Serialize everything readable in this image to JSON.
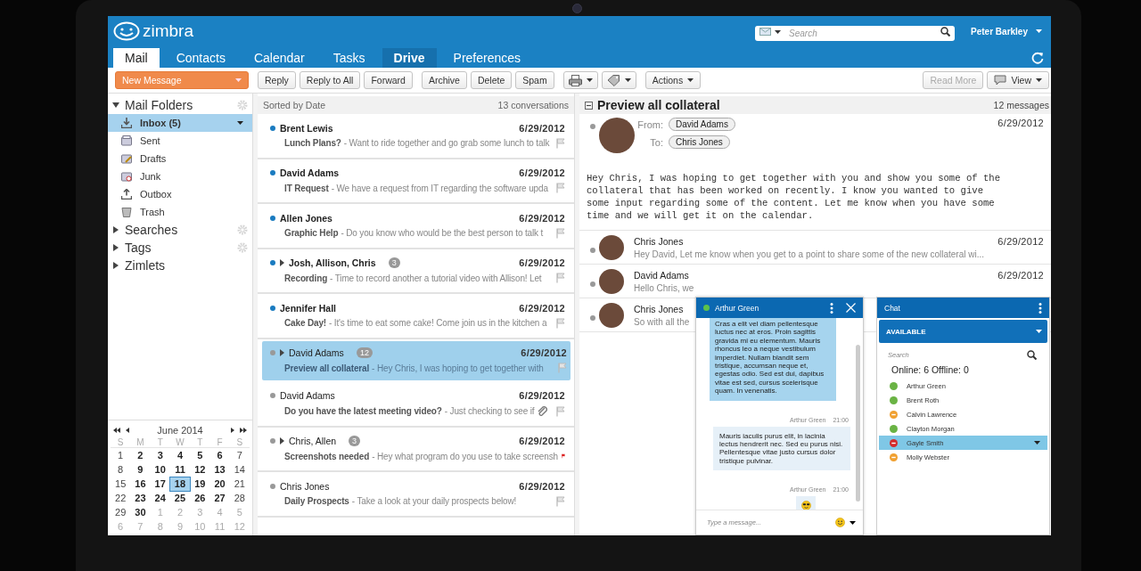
{
  "header": {
    "logo": "zimbra",
    "search": {
      "placeholder": "Search"
    },
    "user": "Peter Barkley"
  },
  "tabs": [
    {
      "label": "Mail",
      "selected": true,
      "highlighted": false
    },
    {
      "label": "Contacts",
      "selected": false,
      "highlighted": false
    },
    {
      "label": "Calendar",
      "selected": false,
      "highlighted": false
    },
    {
      "label": "Tasks",
      "selected": false,
      "highlighted": false
    },
    {
      "label": "Drive",
      "selected": false,
      "highlighted": true
    },
    {
      "label": "Preferences",
      "selected": false,
      "highlighted": false
    }
  ],
  "toolbar": {
    "groups": [
      [
        {
          "kind": "primary",
          "label": "New Message"
        }
      ],
      [
        {
          "kind": "button",
          "label": "Reply"
        },
        {
          "kind": "button",
          "label": "Reply to All"
        },
        {
          "kind": "button",
          "label": "Forward"
        }
      ],
      [
        {
          "kind": "button",
          "label": "Archive"
        },
        {
          "kind": "button",
          "label": "Delete"
        },
        {
          "kind": "button",
          "label": "Spam"
        }
      ],
      [
        {
          "kind": "print-menu"
        },
        {
          "kind": "tag-menu"
        }
      ],
      [
        {
          "kind": "menu",
          "label": "Actions"
        }
      ]
    ],
    "right": [
      {
        "kind": "button",
        "label": "Read More",
        "disabled": true
      },
      {
        "kind": "view-menu",
        "label": "View",
        "disabled": false
      }
    ]
  },
  "sidebar": {
    "sections": [
      {
        "label": "Mail Folders",
        "expanded": true,
        "settings": true,
        "children": [
          {
            "label": "Inbox (5)",
            "kind": "inbox",
            "selected": true
          },
          {
            "label": "Sent",
            "kind": "sent",
            "selected": false
          },
          {
            "label": "Drafts",
            "kind": "drafts",
            "selected": false
          },
          {
            "label": "Junk",
            "kind": "junk",
            "selected": false
          },
          {
            "label": "Outbox",
            "kind": "outbox",
            "selected": false
          },
          {
            "label": "Trash",
            "kind": "trash",
            "selected": false
          }
        ]
      },
      {
        "label": "Searches",
        "expanded": false,
        "settings": true
      },
      {
        "label": "Tags",
        "expanded": false,
        "settings": true
      },
      {
        "label": "Zimlets",
        "expanded": false,
        "settings": false
      }
    ]
  },
  "calendar": {
    "month": "June 2014",
    "weekdays": [
      "S",
      "M",
      "T",
      "W",
      "T",
      "F",
      "S"
    ],
    "weeks": [
      [
        {
          "day": "1",
          "kind": "weekend",
          "selected": false
        },
        {
          "day": "2",
          "kind": "weekday",
          "selected": false
        },
        {
          "day": "3",
          "kind": "weekday",
          "selected": false
        },
        {
          "day": "4",
          "kind": "weekday",
          "selected": false
        },
        {
          "day": "5",
          "kind": "weekday",
          "selected": false
        },
        {
          "day": "6",
          "kind": "weekday",
          "selected": false
        },
        {
          "day": "7",
          "kind": "weekend",
          "selected": false
        }
      ],
      [
        {
          "day": "8",
          "kind": "weekend",
          "selected": false
        },
        {
          "day": "9",
          "kind": "weekday",
          "selected": false
        },
        {
          "day": "10",
          "kind": "weekday",
          "selected": false
        },
        {
          "day": "11",
          "kind": "weekday",
          "selected": false
        },
        {
          "day": "12",
          "kind": "weekday",
          "selected": false
        },
        {
          "day": "13",
          "kind": "weekday",
          "selected": false
        },
        {
          "day": "14",
          "kind": "weekend",
          "selected": false
        }
      ],
      [
        {
          "day": "15",
          "kind": "weekend",
          "selected": false
        },
        {
          "day": "16",
          "kind": "weekday",
          "selected": false
        },
        {
          "day": "17",
          "kind": "weekday",
          "selected": false
        },
        {
          "day": "18",
          "kind": "weekday",
          "selected": true
        },
        {
          "day": "19",
          "kind": "weekday",
          "selected": false
        },
        {
          "day": "20",
          "kind": "weekday",
          "selected": false
        },
        {
          "day": "21",
          "kind": "weekend",
          "selected": false
        }
      ],
      [
        {
          "day": "22",
          "kind": "weekend",
          "selected": false
        },
        {
          "day": "23",
          "kind": "weekday",
          "selected": false
        },
        {
          "day": "24",
          "kind": "weekday",
          "selected": false
        },
        {
          "day": "25",
          "kind": "weekday",
          "selected": false
        },
        {
          "day": "26",
          "kind": "weekday",
          "selected": false
        },
        {
          "day": "27",
          "kind": "weekday",
          "selected": false
        },
        {
          "day": "28",
          "kind": "weekend",
          "selected": false
        }
      ],
      [
        {
          "day": "29",
          "kind": "weekend",
          "selected": false
        },
        {
          "day": "30",
          "kind": "weekday",
          "selected": false
        },
        {
          "day": "1",
          "kind": "other",
          "selected": false
        },
        {
          "day": "2",
          "kind": "other",
          "selected": false
        },
        {
          "day": "3",
          "kind": "other",
          "selected": false
        },
        {
          "day": "4",
          "kind": "other",
          "selected": false
        },
        {
          "day": "5",
          "kind": "other",
          "selected": false
        }
      ],
      [
        {
          "day": "6",
          "kind": "other",
          "selected": false
        },
        {
          "day": "7",
          "kind": "other",
          "selected": false
        },
        {
          "day": "8",
          "kind": "other",
          "selected": false
        },
        {
          "day": "9",
          "kind": "other",
          "selected": false
        },
        {
          "day": "10",
          "kind": "other",
          "selected": false
        },
        {
          "day": "11",
          "kind": "other",
          "selected": false
        },
        {
          "day": "12",
          "kind": "other",
          "selected": false
        }
      ]
    ]
  },
  "message_list": {
    "sort": "Sorted by Date",
    "count": "13 conversations",
    "rows": [
      {
        "sender": "Brent Lewis",
        "date": "6/29/2012",
        "subject": "Lunch Plans?",
        "snippet": "- Want to ride together and go grab some lunch to talk",
        "unread": true,
        "thread": false,
        "flagged": false,
        "attachment": false,
        "selected": false
      },
      {
        "sender": "David Adams",
        "date": "6/29/2012",
        "subject": "IT Request",
        "snippet": "- We have a request from IT regarding the software upda",
        "unread": true,
        "thread": false,
        "flagged": false,
        "attachment": false,
        "selected": false
      },
      {
        "sender": "Allen Jones",
        "date": "6/29/2012",
        "subject": "Graphic Help",
        "snippet": "- Do you know who would be the best person to talk t",
        "unread": true,
        "thread": false,
        "flagged": false,
        "attachment": false,
        "selected": false
      },
      {
        "sender": "Josh, Allison, Chris",
        "count": "3",
        "date": "6/29/2012",
        "subject": "Recording",
        "snippet": "- Time to record another a tutorial video with Allison! Let",
        "unread": true,
        "thread": true,
        "flagged": false,
        "attachment": false,
        "selected": false
      },
      {
        "sender": "Jennifer Hall",
        "date": "6/29/2012",
        "subject": "Cake Day!",
        "snippet": "- It's time to eat some cake! Come join us in the kitchen a",
        "unread": true,
        "thread": false,
        "flagged": false,
        "attachment": false,
        "selected": false
      },
      {
        "sender": "David Adams",
        "count": "12",
        "date": "6/29/2012",
        "subject": "Preview all collateral",
        "snippet": "- Hey Chris, I was hoping to get together with",
        "unread": false,
        "thread": true,
        "flagged": false,
        "attachment": false,
        "selected": true
      },
      {
        "sender": "David Adams",
        "date": "6/29/2012",
        "subject": "Do you have the latest meeting video?",
        "snippet": "- Just checking to see if",
        "unread": false,
        "thread": false,
        "flagged": false,
        "attachment": true,
        "selected": false
      },
      {
        "sender": "Chris, Allen",
        "count": "3",
        "date": "6/29/2012",
        "subject": "Screenshots needed",
        "snippet": "- Hey what program do you use to take screensh",
        "unread": false,
        "thread": true,
        "flagged": true,
        "attachment": false,
        "selected": false
      },
      {
        "sender": "Chris Jones",
        "date": "6/29/2012",
        "subject": "Daily Prospects",
        "snippet": "- Take a look at your daily prospects below!",
        "unread": false,
        "thread": false,
        "flagged": false,
        "attachment": false,
        "selected": false
      }
    ]
  },
  "reading_pane": {
    "title": "Preview all collateral",
    "count": "12 messages",
    "message": {
      "from_label": "From:",
      "from": "David Adams",
      "to_label": "To:",
      "to": "Chris Jones",
      "date": "6/29/2012",
      "body": "Hey Chris, I was hoping to get together with you and show you some of the collateral that has been worked on recently. I know you wanted to give some input regarding some of the content. Let me know when you have some time and we will get it on the calendar."
    },
    "thread": [
      {
        "name": "Chris Jones",
        "date": "6/29/2012",
        "snippet": "Hey David, Let me know when you get to a point to share some of the new collateral wi..."
      },
      {
        "name": "David Adams",
        "date": "6/29/2012",
        "snippet": "Hello Chris, we"
      },
      {
        "name": "Chris Jones",
        "snippet": "So with all the"
      }
    ]
  },
  "chat_window": {
    "name": "Arthur Green",
    "messages": [
      {
        "kind": "received",
        "text": "Cras a elit vel diam pellentesque luctus nec at eros. Proin sagittis gravida mi eu elementum. Mauris rhoncus leo a neque vestibulum imperdiet. Nullam blandit sem tristique, accumsan neque et, egestas odio. Sed est dui, dapibus vitae est sed, cursus scelerisque quam. In venenatis."
      },
      {
        "kind": "meta",
        "sender": "Arthur Green",
        "time": "21:00"
      },
      {
        "kind": "sent",
        "text": "Mauris iaculis purus elit, in lacinia lectus hendrerit nec. Sed eu purus nisi. Pellentesque vitae justo cursus dolor tristique pulvinar."
      },
      {
        "kind": "meta",
        "sender": "Arthur Green",
        "time": "21:00"
      },
      {
        "kind": "emoji"
      }
    ],
    "placeholder": "Type a message..."
  },
  "chat_panel": {
    "title": "Chat",
    "status": "AVAILABLE",
    "search": {
      "placeholder": "Search"
    },
    "summary": "Online: 6 Offline: 0",
    "contacts": [
      {
        "name": "Arthur Green",
        "kind": "available",
        "color": "#6ab344",
        "selected": false
      },
      {
        "name": "Brent Roth",
        "kind": "available",
        "color": "#6ab344",
        "selected": false
      },
      {
        "name": "Calvin Lawrence",
        "kind": "away",
        "color": "#f0a030",
        "selected": false
      },
      {
        "name": "Clayton Morgan",
        "kind": "available",
        "color": "#6ab344",
        "selected": false
      },
      {
        "name": "Gayle Smith",
        "kind": "busy",
        "color": "#d42a2a",
        "selected": true
      },
      {
        "name": "Molly Webster",
        "kind": "away",
        "color": "#f0a030",
        "selected": false
      }
    ]
  }
}
